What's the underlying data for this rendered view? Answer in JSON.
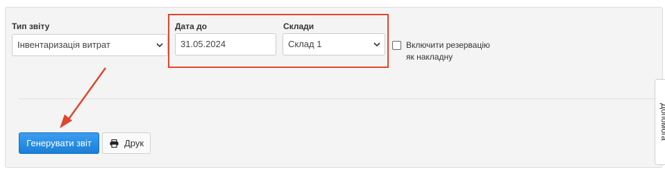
{
  "report_type": {
    "label": "Тип звіту",
    "value": "Інвентаризація витрат"
  },
  "date_to": {
    "label": "Дата до",
    "value": "31.05.2024"
  },
  "warehouses": {
    "label": "Склади",
    "value": "Склад 1"
  },
  "include_reservation": {
    "label_line1": "Включити резервацію",
    "label_line2": "як накладну",
    "checked": false
  },
  "buttons": {
    "generate": "Генерувати звіт",
    "print": "Друк"
  },
  "help_tab": {
    "label": "Допомога"
  },
  "colors": {
    "accent": "#1a7fd6",
    "annotation": "#e0462b"
  },
  "icons": {
    "select_chevron": "chevron-down-icon",
    "print": "printer-icon",
    "annotation": "arrow-annotation"
  }
}
